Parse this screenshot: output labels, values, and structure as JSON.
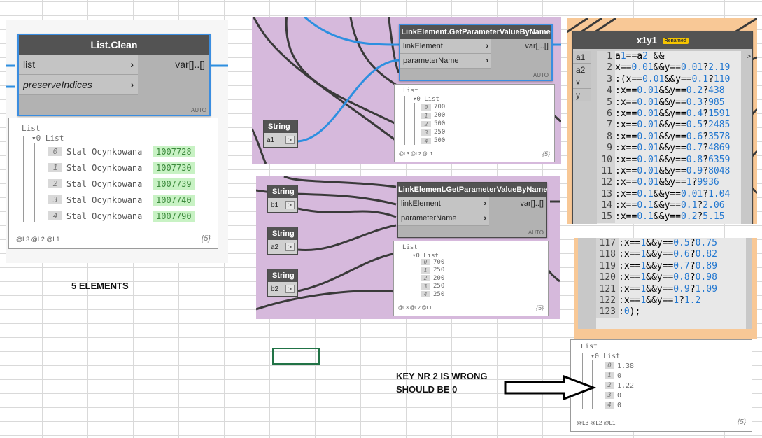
{
  "list_clean": {
    "title": "List.Clean",
    "inputs": [
      "list",
      "preserveIndices"
    ],
    "output": "var[]..[]",
    "auto": "AUTO",
    "preview": {
      "header": "List",
      "sub": "0 List",
      "rows": [
        {
          "i": "0",
          "name": "Stal Ocynkowana",
          "val": "1007728"
        },
        {
          "i": "1",
          "name": "Stal Ocynkowana",
          "val": "1007730"
        },
        {
          "i": "2",
          "name": "Stal Ocynkowana",
          "val": "1007739"
        },
        {
          "i": "3",
          "name": "Stal Ocynkowana",
          "val": "1007740"
        },
        {
          "i": "4",
          "name": "Stal Ocynkowana",
          "val": "1007790"
        }
      ],
      "levels": "@L3 @L2 @L1",
      "count": "{5}"
    }
  },
  "label_5_elements": "5 ELEMENTS",
  "link_node_1": {
    "title": "LinkElement.GetParameterValueByName",
    "inputs": [
      "linkElement",
      "parameterName"
    ],
    "output": "var[]..[]",
    "auto": "AUTO",
    "preview": {
      "header": "List",
      "sub": "0 List",
      "rows": [
        {
          "i": "0",
          "v": "700"
        },
        {
          "i": "1",
          "v": "200"
        },
        {
          "i": "2",
          "v": "500"
        },
        {
          "i": "3",
          "v": "250"
        },
        {
          "i": "4",
          "v": "500"
        }
      ],
      "levels": "@L3 @L2 @L1",
      "count": "{5}"
    }
  },
  "string_a1": {
    "title": "String",
    "value": "a1",
    "btn": ">"
  },
  "link_node_2": {
    "title": "LinkElement.GetParameterValueByName",
    "inputs": [
      "linkElement",
      "parameterName"
    ],
    "output": "var[]..[]",
    "auto": "AUTO",
    "preview": {
      "header": "List",
      "sub": "0 List",
      "rows": [
        {
          "i": "0",
          "v": "700"
        },
        {
          "i": "1",
          "v": "250"
        },
        {
          "i": "2",
          "v": "200"
        },
        {
          "i": "3",
          "v": "250"
        },
        {
          "i": "4",
          "v": "250"
        }
      ],
      "levels": "@L3 @L2 @L1",
      "count": "{5}"
    }
  },
  "string_b1": {
    "title": "String",
    "value": "b1",
    "btn": ">"
  },
  "string_a2": {
    "title": "String",
    "value": "a2",
    "btn": ">"
  },
  "string_b2": {
    "title": "String",
    "value": "b2",
    "btn": ">"
  },
  "code_block": {
    "title": "x1y1",
    "badge": "Renamed",
    "inputs": [
      "a1",
      "a2",
      "x",
      "y"
    ],
    "output_btn": ">",
    "lines_top": [
      {
        "n": "1",
        "t": "a1==a2 &&"
      },
      {
        "n": "2",
        "t": "x==0.01&&y==0.01?2.19"
      },
      {
        "n": "3",
        "t": ":(x==0.01&&y==0.1?110"
      },
      {
        "n": "4",
        "t": ":x==0.01&&y==0.2?438"
      },
      {
        "n": "5",
        "t": ":x==0.01&&y==0.3?985"
      },
      {
        "n": "6",
        "t": ":x==0.01&&y==0.4?1591"
      },
      {
        "n": "7",
        "t": ":x==0.01&&y==0.5?2485"
      },
      {
        "n": "8",
        "t": ":x==0.01&&y==0.6?3578"
      },
      {
        "n": "9",
        "t": ":x==0.01&&y==0.7?4869"
      },
      {
        "n": "10",
        "t": ":x==0.01&&y==0.8?6359"
      },
      {
        "n": "11",
        "t": ":x==0.01&&y==0.9?8048"
      },
      {
        "n": "12",
        "t": ":x==0.01&&y==1?9936"
      },
      {
        "n": "13",
        "t": ":x==0.1&&y==0.01?1.04"
      },
      {
        "n": "14",
        "t": ":x==0.1&&y==0.1?2.06"
      },
      {
        "n": "15",
        "t": ":x==0.1&&y==0.2?5.15"
      }
    ],
    "lines_bottom": [
      {
        "n": "117",
        "t": ":x==1&&y==0.5?0.75"
      },
      {
        "n": "118",
        "t": ":x==1&&y==0.6?0.82"
      },
      {
        "n": "119",
        "t": ":x==1&&y==0.7?0.89"
      },
      {
        "n": "120",
        "t": ":x==1&&y==0.8?0.98"
      },
      {
        "n": "121",
        "t": ":x==1&&y==0.9?1.09"
      },
      {
        "n": "122",
        "t": ":x==1&&y==1?1.2"
      },
      {
        "n": "123",
        "t": ":0);"
      }
    ],
    "preview": {
      "header": "List",
      "sub": "0 List",
      "rows": [
        {
          "i": "0",
          "v": "1.38"
        },
        {
          "i": "1",
          "v": "0"
        },
        {
          "i": "2",
          "v": "1.22"
        },
        {
          "i": "3",
          "v": "0"
        },
        {
          "i": "4",
          "v": "0"
        }
      ],
      "levels": "@L3 @L2 @L1",
      "count": "{5}"
    }
  },
  "annotation": {
    "line1": "KEY NR 2 IS WRONG",
    "line2": "SHOULD BE 0"
  },
  "colors": {
    "purple_canvas": "#d6b9dc",
    "orange_canvas": "#f8c896",
    "wire_blue": "#2d8fe0",
    "node_header": "#535353"
  }
}
